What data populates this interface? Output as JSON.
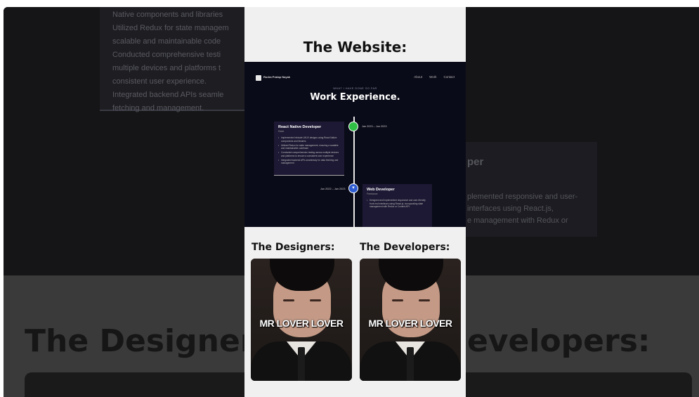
{
  "background": {
    "bullets": [
      "Native components and libraries",
      "Utilized Redux for state managem",
      "scalable and maintainable code",
      "Conducted comprehensive testi",
      "multiple devices and platforms t",
      "consistent user experience.",
      "Integrated backend APIs seamle",
      "fetching and management."
    ],
    "right_title": "per",
    "right_lines": [
      "plemented responsive and user-",
      "interfaces using React.js,",
      "e management with Redux or"
    ],
    "big_left": "The Designer",
    "big_right": "evelopers:"
  },
  "panel": {
    "heading": "The Website:",
    "website": {
      "brand": "Rudra Pratap Nayak",
      "nav": [
        "About",
        "Work",
        "Contact"
      ],
      "subtitle": "WHAT I HAVE DONE SO FAR",
      "title": "Work Experience.",
      "jobs": [
        {
          "title": "React Native Developer",
          "company": "Rabit",
          "date": "Jan 2023 – Jun 2023",
          "bullets": [
            "Implemented intricate UI/UX designs using React Native components and libraries",
            "Utilized Redux for state management, ensuring a scalable and maintainable codebase",
            "Conducted comprehensive testing across multiple devices and platforms to ensure a consistent user experience",
            "Integrated backend APIs seamlessly for data fetching and management"
          ]
        },
        {
          "title": "Web Developer",
          "company": "Freelance",
          "date": "Jun 2022 – Jan 2023",
          "bullets": [
            "Designed and implemented responsive and user-friendly front end interfaces using React.js, incorporating state management with Redux or Context API."
          ]
        }
      ]
    },
    "designers_heading": "The Designers:",
    "developers_heading": "The Developers:",
    "meme_caption": "MR LOVER LOVER"
  }
}
